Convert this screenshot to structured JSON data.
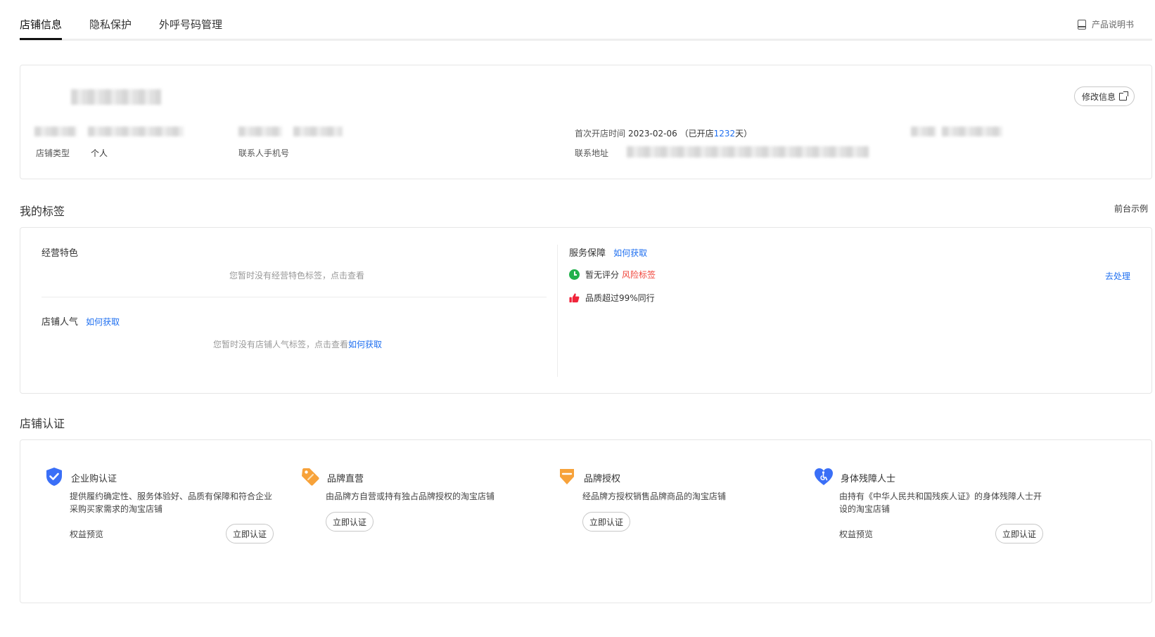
{
  "tabs": {
    "store_info": "店铺信息",
    "privacy": "隐私保护",
    "outbound_numbers": "外呼号码管理",
    "manual": "产品说明书"
  },
  "store": {
    "edit_label": "修改信息",
    "store_type_label": "店铺类型",
    "store_type_value": "个人",
    "contact_phone_label": "联系人手机号",
    "first_open_label": "首次开店时间",
    "first_open_date": "2023-02-06",
    "opened_prefix": "（已开店",
    "opened_days": "1232",
    "opened_suffix": "天）",
    "address_label": "联系地址"
  },
  "tags": {
    "title": "我的标签",
    "front_demo": "前台示例",
    "features_title": "经营特色",
    "features_empty": "您暂时没有经营特色标签，点击查看",
    "popularity_title": "店铺人气",
    "popularity_link": "如何获取",
    "popularity_empty": "您暂时没有店铺人气标签，点击查看",
    "popularity_empty_link": "如何获取",
    "service_title": "服务保障",
    "service_link": "如何获取",
    "no_rating": "暂无评分",
    "risk_tag": "风险标签",
    "go_handle": "去处理",
    "quality": "品质超过99%同行"
  },
  "certification": {
    "title": "店铺认证",
    "items": [
      {
        "title": "企业购认证",
        "desc": "提供履约确定性、服务体验好、品质有保障和符合企业采购买家需求的淘宝店铺",
        "preview": "权益预览",
        "button": "立即认证",
        "icon": "shield-check-icon",
        "color": "#3a6ff7"
      },
      {
        "title": "品牌直营",
        "desc": "由品牌方自营或持有独占品牌授权的淘宝店铺",
        "preview": "",
        "button": "立即认证",
        "icon": "tag-icon",
        "color": "#f7a23a"
      },
      {
        "title": "品牌授权",
        "desc": "经品牌方授权销售品牌商品的淘宝店铺",
        "preview": "",
        "button": "立即认证",
        "icon": "diamond-icon",
        "color": "#f7a23a"
      },
      {
        "title": "身体残障人士",
        "desc": "由持有《中华人民共和国残疾人证》的身体残障人士开设的淘宝店铺",
        "preview": "权益预览",
        "button": "立即认证",
        "icon": "accessibility-heart-icon",
        "color": "#3a6ff7"
      }
    ]
  }
}
